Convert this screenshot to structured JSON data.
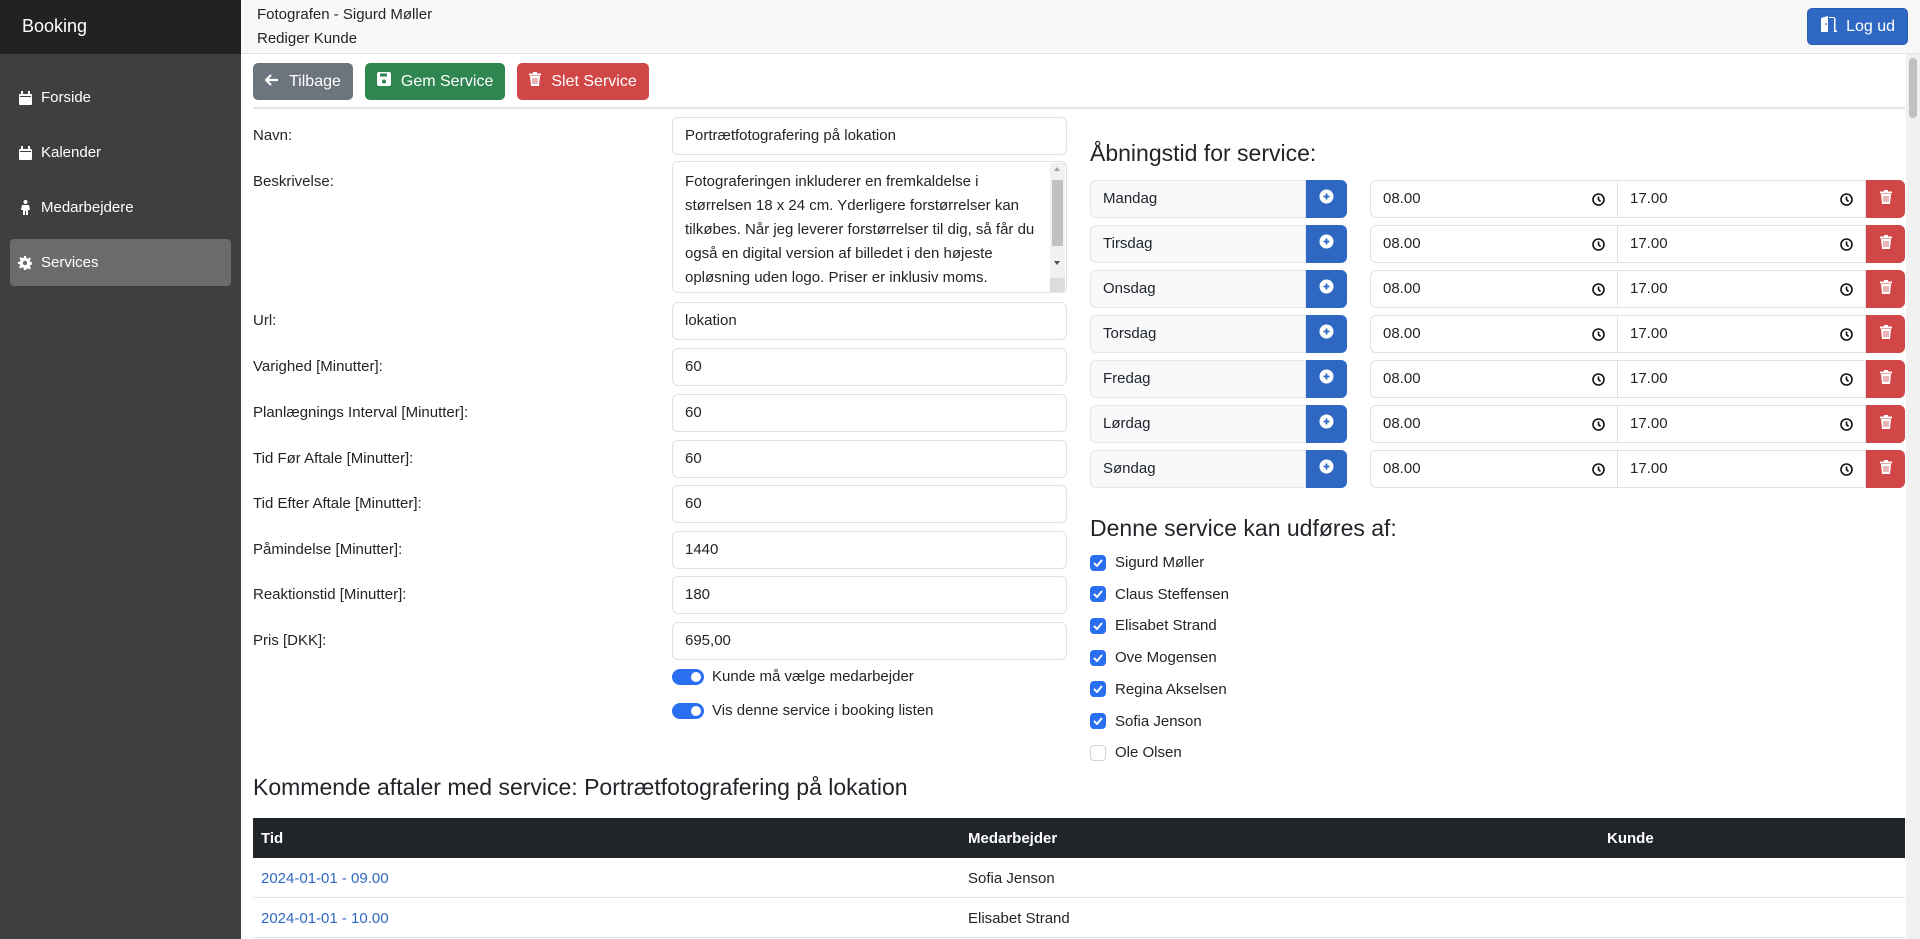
{
  "sidebar": {
    "brand": "Booking",
    "items": [
      {
        "label": "Forside",
        "icon": "calendar-icon",
        "active": false
      },
      {
        "label": "Kalender",
        "icon": "calendar-icon",
        "active": false
      },
      {
        "label": "Medarbejdere",
        "icon": "person-icon",
        "active": false
      },
      {
        "label": "Services",
        "icon": "gear-icon",
        "active": true
      }
    ]
  },
  "header": {
    "title": "Fotografen - Sigurd Møller",
    "subtitle": "Rediger Kunde",
    "logout_label": "Log ud"
  },
  "toolbar": {
    "back_label": "Tilbage",
    "save_label": "Gem Service",
    "delete_label": "Slet Service"
  },
  "form": {
    "name_label": "Navn:",
    "name_value": "Portrætfotografering på lokation",
    "description_label": "Beskrivelse:",
    "description_value": "Fotograferingen inkluderer en fremkaldelse i størrelsen 18 x 24 cm. Yderligere forstørrelser kan tilkøbes. Når jeg leverer forstørrelser til dig, så får du også en digital version af billedet i den højeste opløsning uden logo. Priser er inklusiv moms.",
    "fields": [
      {
        "label": "Url:",
        "value": "lokation"
      },
      {
        "label": "Varighed [Minutter]:",
        "value": "60"
      },
      {
        "label": "Planlægnings Interval [Minutter]:",
        "value": "60"
      },
      {
        "label": "Tid Før Aftale [Minutter]:",
        "value": "60"
      },
      {
        "label": "Tid Efter Aftale [Minutter]:",
        "value": "60"
      },
      {
        "label": "Påmindelse [Minutter]:",
        "value": "1440"
      },
      {
        "label": "Reaktionstid [Minutter]:",
        "value": "180"
      },
      {
        "label": "Pris [DKK]:",
        "value": "695,00"
      }
    ],
    "switches": [
      {
        "label": "Kunde må vælge medarbejder",
        "checked": true
      },
      {
        "label": "Vis denne service i booking listen",
        "checked": true
      }
    ]
  },
  "opening_hours": {
    "title": "Åbningstid for service:",
    "days": [
      {
        "day": "Mandag",
        "from": "08.00",
        "to": "17.00"
      },
      {
        "day": "Tirsdag",
        "from": "08.00",
        "to": "17.00"
      },
      {
        "day": "Onsdag",
        "from": "08.00",
        "to": "17.00"
      },
      {
        "day": "Torsdag",
        "from": "08.00",
        "to": "17.00"
      },
      {
        "day": "Fredag",
        "from": "08.00",
        "to": "17.00"
      },
      {
        "day": "Lørdag",
        "from": "08.00",
        "to": "17.00"
      },
      {
        "day": "Søndag",
        "from": "08.00",
        "to": "17.00"
      }
    ]
  },
  "performers": {
    "title": "Denne service kan udføres af:",
    "employees": [
      {
        "name": "Sigurd Møller",
        "checked": true
      },
      {
        "name": "Claus Steffensen",
        "checked": true
      },
      {
        "name": "Elisabet Strand",
        "checked": true
      },
      {
        "name": "Ove Mogensen",
        "checked": true
      },
      {
        "name": "Regina Akselsen",
        "checked": true
      },
      {
        "name": "Sofia Jenson",
        "checked": true
      },
      {
        "name": "Ole Olsen",
        "checked": false
      }
    ]
  },
  "upcoming": {
    "title": "Kommende aftaler med service: Portrætfotografering på lokation",
    "columns": [
      "Tid",
      "Medarbejder",
      "Kunde"
    ],
    "rows": [
      {
        "time": "2024-01-01 - 09.00",
        "employee": "Sofia Jenson",
        "customer": ""
      },
      {
        "time": "2024-01-01 - 10.00",
        "employee": "Elisabet Strand",
        "customer": ""
      }
    ]
  },
  "colors": {
    "primary": "#2f68c2",
    "success": "#2f8650",
    "danger": "#d14747",
    "secondary": "#6c757d",
    "sidebar": "#3f3f3f",
    "brand_bar": "#222222"
  }
}
